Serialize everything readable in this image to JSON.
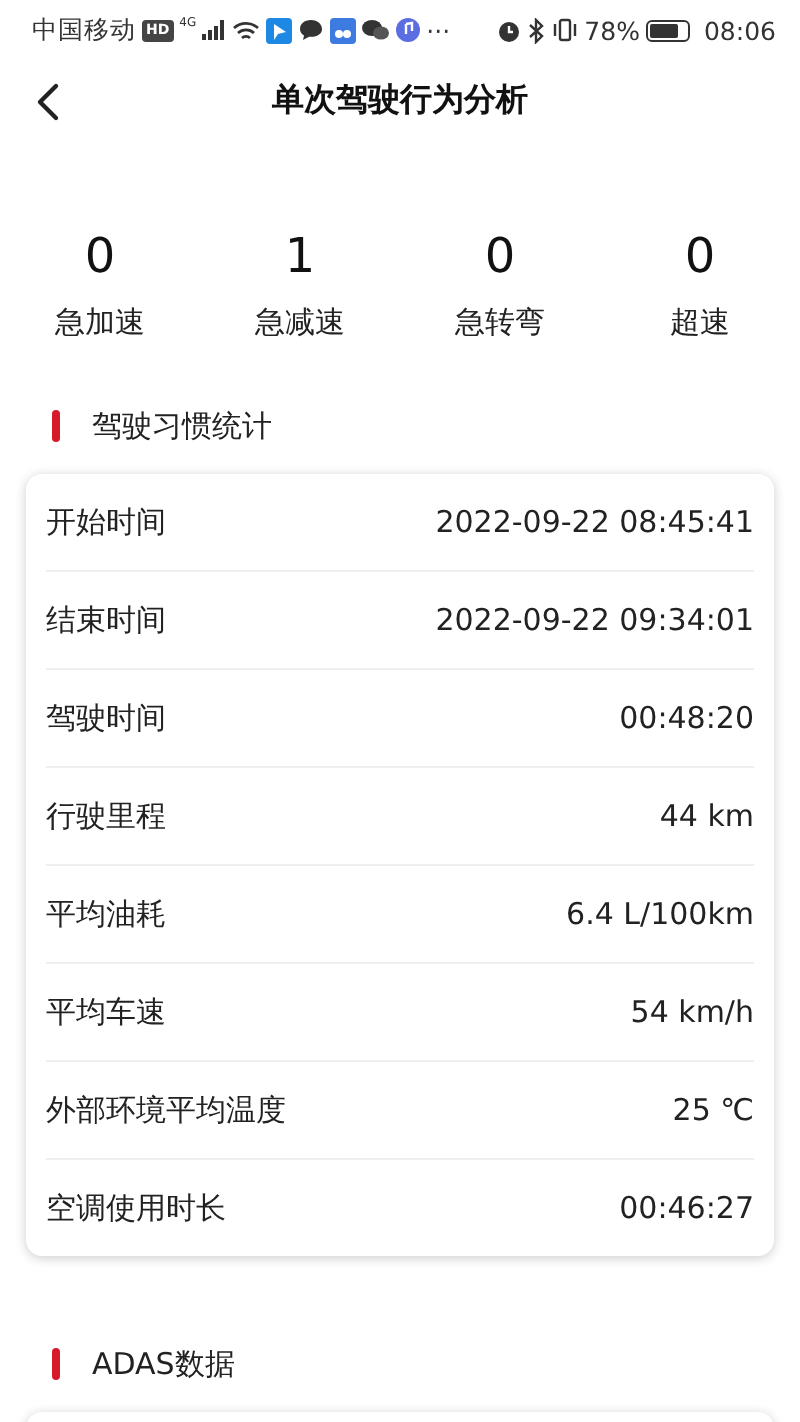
{
  "status_bar": {
    "carrier": "中国移动",
    "hd": "HD",
    "network": "4G",
    "more": "···",
    "battery": "78%",
    "time": "08:06"
  },
  "header": {
    "title": "单次驾驶行为分析"
  },
  "stats": [
    {
      "value": "0",
      "label": "急加速"
    },
    {
      "value": "1",
      "label": "急减速"
    },
    {
      "value": "0",
      "label": "急转弯"
    },
    {
      "value": "0",
      "label": "超速"
    }
  ],
  "sections": [
    {
      "title": "驾驶习惯统计",
      "rows": [
        {
          "label": "开始时间",
          "value": "2022-09-22 08:45:41"
        },
        {
          "label": "结束时间",
          "value": "2022-09-22 09:34:01"
        },
        {
          "label": "驾驶时间",
          "value": "00:48:20"
        },
        {
          "label": "行驶里程",
          "value": "44 km"
        },
        {
          "label": "平均油耗",
          "value": "6.4 L/100km"
        },
        {
          "label": "平均车速",
          "value": "54 km/h"
        },
        {
          "label": "外部环境平均温度",
          "value": "25 ℃"
        },
        {
          "label": "空调使用时长",
          "value": "00:46:27"
        }
      ]
    },
    {
      "title": "ADAS数据"
    }
  ]
}
